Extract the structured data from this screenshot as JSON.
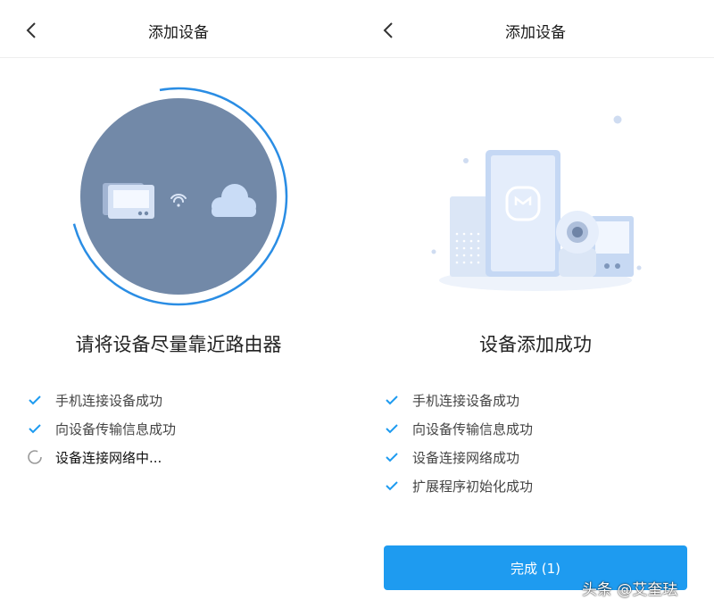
{
  "left": {
    "title": "添加设备",
    "heading": "请将设备尽量靠近路由器",
    "steps": [
      {
        "label": "手机连接设备成功",
        "status": "done"
      },
      {
        "label": "向设备传输信息成功",
        "status": "done"
      },
      {
        "label": "设备连接网络中...",
        "status": "loading"
      }
    ]
  },
  "right": {
    "title": "添加设备",
    "heading": "设备添加成功",
    "steps": [
      {
        "label": "手机连接设备成功",
        "status": "done"
      },
      {
        "label": "向设备传输信息成功",
        "status": "done"
      },
      {
        "label": "设备连接网络成功",
        "status": "done"
      },
      {
        "label": "扩展程序初始化成功",
        "status": "done"
      }
    ],
    "button_label": "完成 (1)"
  },
  "watermark": "头条 @艾奎珐",
  "colors": {
    "accent": "#1e9bf0",
    "circle": "#7289a8",
    "ring": "#2a8de4"
  },
  "icons": {
    "back": "chevron-left-icon",
    "done": "check-icon",
    "loading": "spinner-icon"
  }
}
